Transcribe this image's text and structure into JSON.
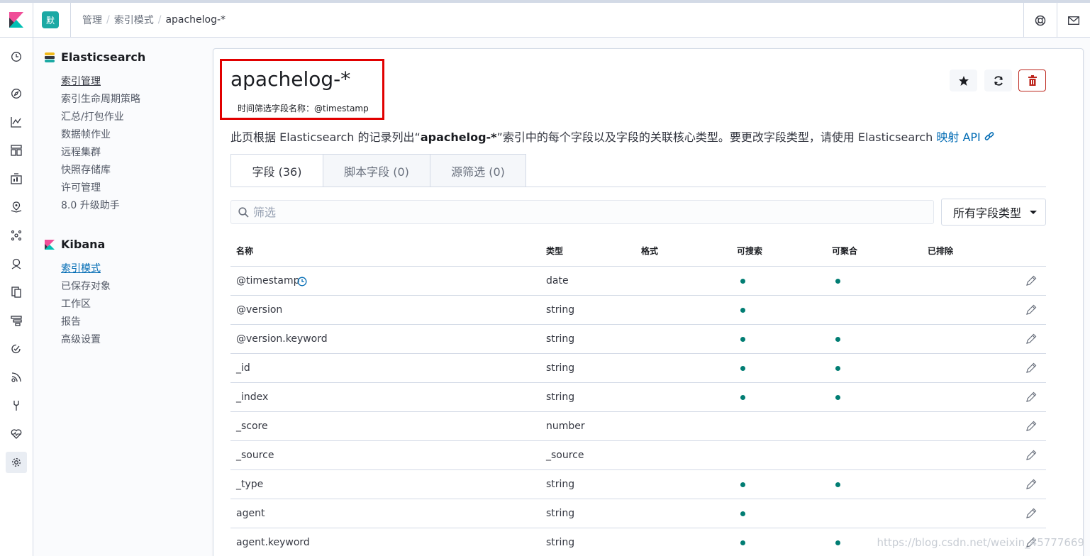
{
  "header": {
    "space_initial": "默",
    "breadcrumbs": [
      "管理",
      "索引模式",
      "apachelog-*"
    ]
  },
  "sidebar": {
    "elasticsearch": {
      "title": "Elasticsearch",
      "items": [
        "索引管理",
        "索引生命周期策略",
        "汇总/打包作业",
        "数据帧作业",
        "远程集群",
        "快照存储库",
        "许可管理",
        "8.0 升级助手"
      ]
    },
    "kibana": {
      "title": "Kibana",
      "items": [
        "索引模式",
        "已保存对象",
        "工作区",
        "报告",
        "高级设置"
      ]
    }
  },
  "main": {
    "title": "apachelog-*",
    "time_field": "时间筛选字段名称：@timestamp",
    "description_prefix": "此页根据 Elasticsearch 的记录列出“",
    "description_bold": "apachelog-*",
    "description_suffix": "”索引中的每个字段以及字段的关联核心类型。要更改字段类型，请使用 Elasticsearch ",
    "description_link": "映射 API",
    "tabs": [
      "字段 (36)",
      "脚本字段 (0)",
      "源筛选 (0)"
    ],
    "search_placeholder": "筛选",
    "type_filter": "所有字段类型",
    "columns": [
      "名称",
      "类型",
      "格式",
      "可搜索",
      "可聚合",
      "已排除"
    ],
    "rows": [
      {
        "name": "@timestamp",
        "type": "date",
        "searchable": true,
        "aggregatable": true
      },
      {
        "name": "@version",
        "type": "string",
        "searchable": true,
        "aggregatable": false
      },
      {
        "name": "@version.keyword",
        "type": "string",
        "searchable": true,
        "aggregatable": true
      },
      {
        "name": "_id",
        "type": "string",
        "searchable": true,
        "aggregatable": true
      },
      {
        "name": "_index",
        "type": "string",
        "searchable": true,
        "aggregatable": true
      },
      {
        "name": "_score",
        "type": "number",
        "searchable": false,
        "aggregatable": false
      },
      {
        "name": "_source",
        "type": "_source",
        "searchable": false,
        "aggregatable": false
      },
      {
        "name": "_type",
        "type": "string",
        "searchable": true,
        "aggregatable": true
      },
      {
        "name": "agent",
        "type": "string",
        "searchable": true,
        "aggregatable": false
      },
      {
        "name": "agent.keyword",
        "type": "string",
        "searchable": true,
        "aggregatable": true
      }
    ]
  },
  "watermark": "https://blog.csdn.net/weixin_45777669",
  "colors": {
    "accent": "#006bb4",
    "dot": "#017d73",
    "highlight": "#e10000",
    "danger": "#bd271e"
  }
}
